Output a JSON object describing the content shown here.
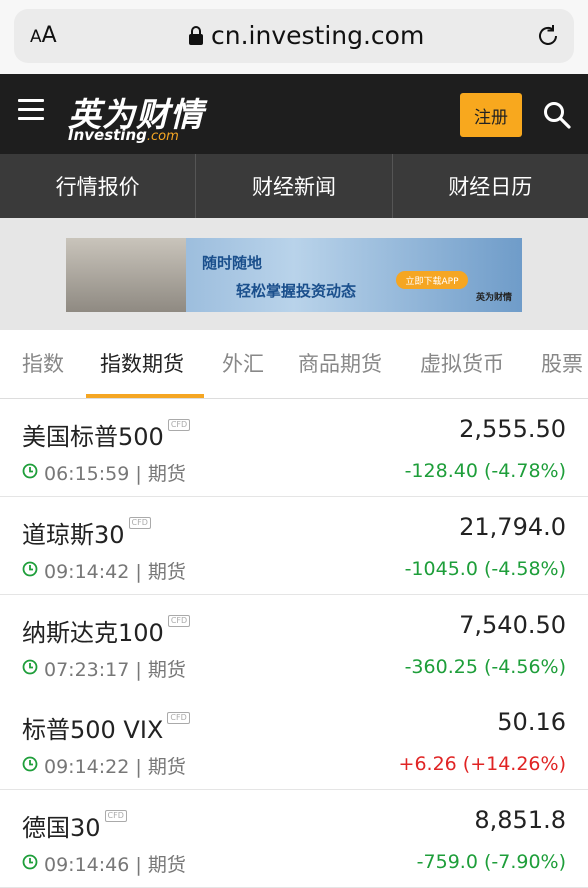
{
  "browser": {
    "aa_small": "A",
    "aa_large": "A",
    "url": "cn.investing.com"
  },
  "header": {
    "logo_cn": "英为财情",
    "logo_en": "Investing",
    "logo_com": ".com",
    "register": "注册"
  },
  "nav": [
    "行情报价",
    "财经新闻",
    "财经日历"
  ],
  "banner": {
    "line1": "随时随地",
    "line2": "轻松掌握投资动态",
    "button": "立即下载APP",
    "logo": "英为财情"
  },
  "tabs": [
    "指数",
    "指数期货",
    "外汇",
    "商品期货",
    "虚拟货币",
    "股票"
  ],
  "active_tab": "指数期货",
  "cfd_label": "CFD",
  "colors": {
    "up": "#e02424",
    "down": "#1e9e3a",
    "accent": "#f5a623"
  },
  "rows": [
    {
      "name": "美国标普500",
      "time": "06:15:59",
      "type": "期货",
      "price": "2,555.50",
      "change": "-128.40 (-4.78%)",
      "dir": "down"
    },
    {
      "name": "道琼斯30",
      "time": "09:14:42",
      "type": "期货",
      "price": "21,794.0",
      "change": "-1045.0 (-4.58%)",
      "dir": "down"
    },
    {
      "name": "纳斯达克100",
      "time": "07:23:17",
      "type": "期货",
      "price": "7,540.50",
      "change": "-360.25 (-4.56%)",
      "dir": "down"
    },
    {
      "name": "标普500 VIX",
      "time": "09:14:22",
      "type": "期货",
      "price": "50.16",
      "change": "+6.26 (+14.26%)",
      "dir": "up"
    },
    {
      "name": "德国30",
      "time": "09:14:46",
      "type": "期货",
      "price": "8,851.8",
      "change": "-759.0 (-7.90%)",
      "dir": "down"
    }
  ]
}
